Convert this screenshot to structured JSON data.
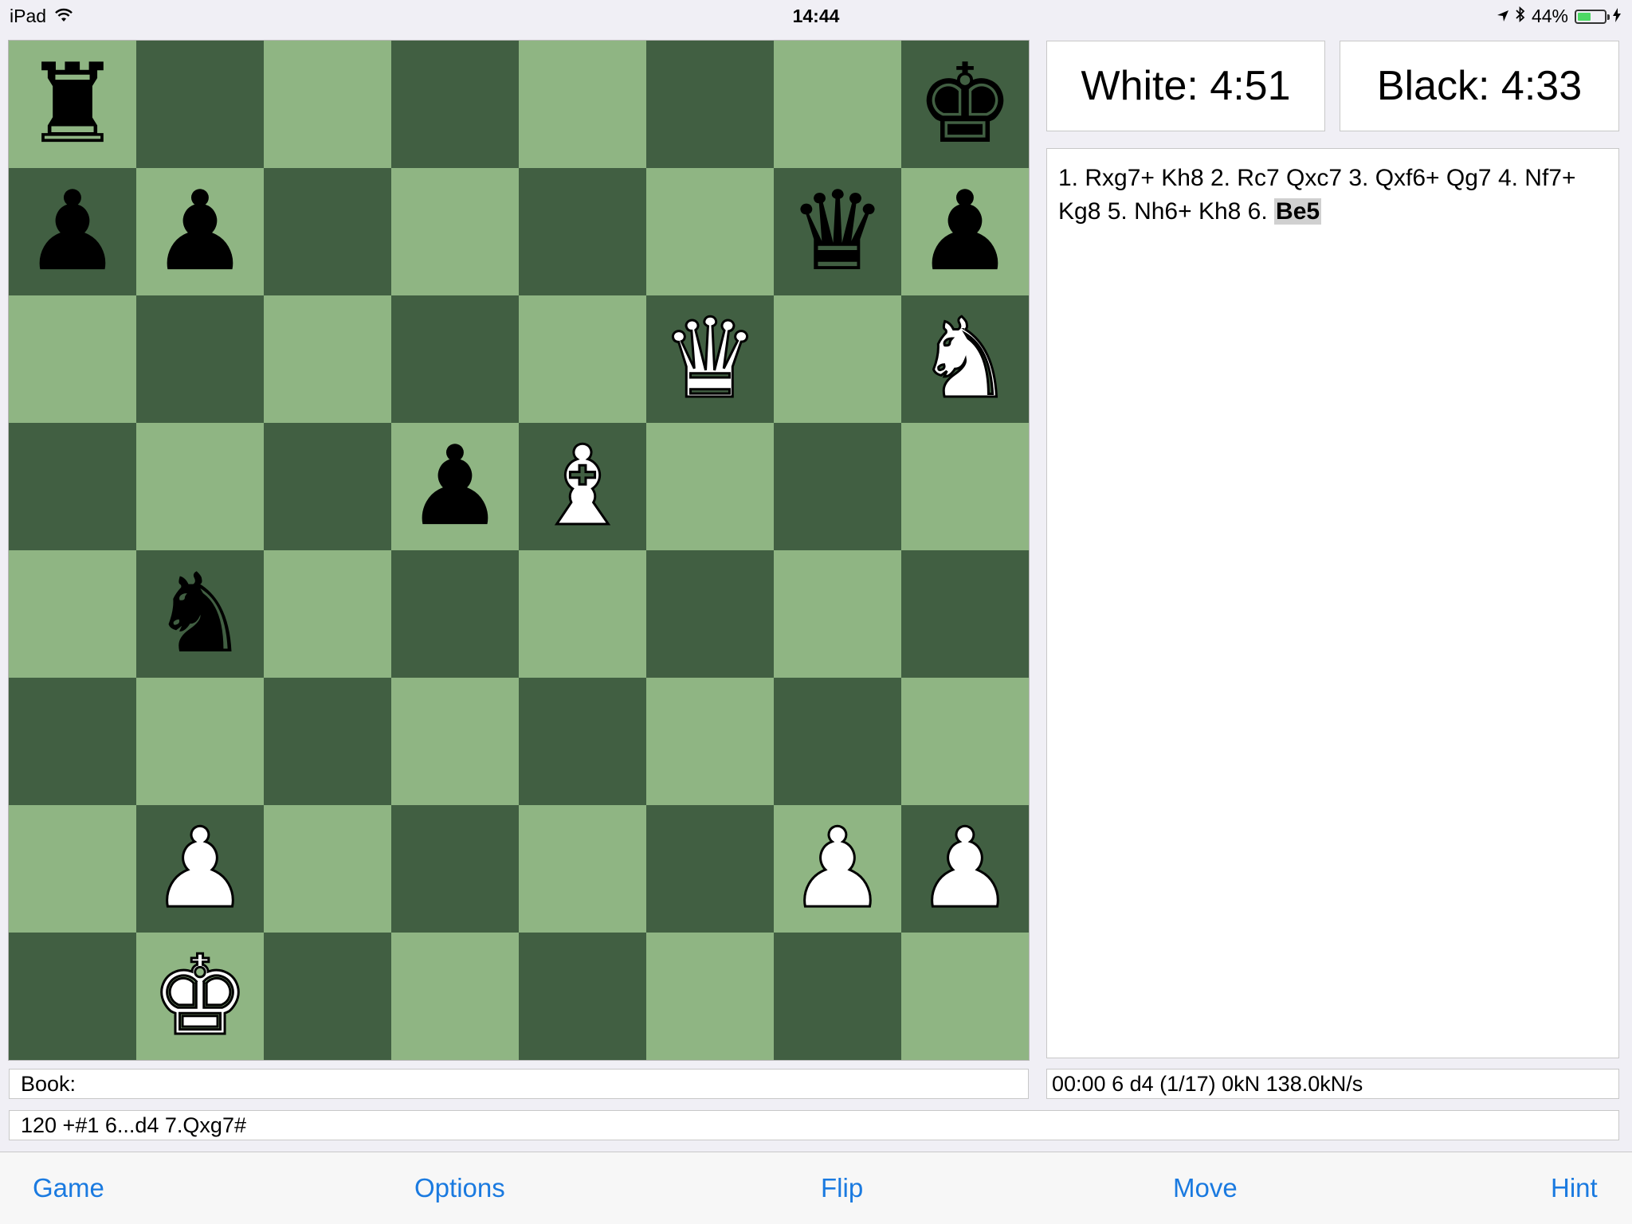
{
  "status_bar": {
    "device": "iPad",
    "time": "14:44",
    "battery": "44%",
    "battery_level": 0.44
  },
  "clocks": {
    "white": "White: 4:51",
    "black": "Black: 4:33"
  },
  "move_list": {
    "text": "1. Rxg7+ Kh8 2. Rc7 Qxc7 3. Qxf6+ Qg7 4. Nf7+ Kg8 5. Nh6+ Kh8 6.",
    "current_move": "Be5"
  },
  "book": "Book:",
  "engine_info": "00:00  6  d4 (1/17)  0kN  138.0kN/s",
  "pv_line": "120 +#1 6...d4 7.Qxg7#",
  "toolbar": {
    "game": "Game",
    "options": "Options",
    "flip": "Flip",
    "move": "Move",
    "hint": "Hint"
  },
  "board": {
    "orientation": "white-bottom",
    "ranks": [
      [
        "bR",
        "",
        "",
        "",
        "",
        "",
        "",
        "bK"
      ],
      [
        "bP",
        "bP",
        "",
        "",
        "",
        "",
        "bQ",
        "bP"
      ],
      [
        "",
        "",
        "",
        "",
        "",
        "wQ",
        "",
        "wN"
      ],
      [
        "",
        "",
        "",
        "bP",
        "wB",
        "",
        "",
        ""
      ],
      [
        "",
        "bN",
        "",
        "",
        "",
        "",
        "",
        ""
      ],
      [
        "",
        "",
        "",
        "",
        "",
        "",
        "",
        ""
      ],
      [
        "",
        "wP",
        "",
        "",
        "",
        "",
        "wP",
        "wP"
      ],
      [
        "",
        "wK",
        "",
        "",
        "",
        "",
        "",
        ""
      ]
    ],
    "files": [
      "a",
      "b",
      "c",
      "d",
      "e",
      "f",
      "g",
      "h"
    ],
    "light_color": "#8fb583",
    "dark_color": "#415f42"
  }
}
